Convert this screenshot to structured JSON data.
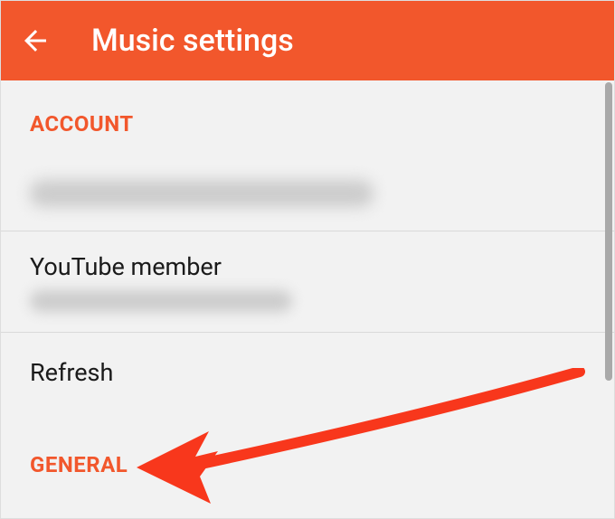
{
  "header": {
    "title": "Music settings",
    "back_icon": "arrow-back"
  },
  "sections": {
    "account": {
      "header": "ACCOUNT",
      "items": {
        "email": {
          "value_redacted": true
        },
        "youtube_member": {
          "title": "YouTube member",
          "subtitle_redacted": true
        },
        "refresh": {
          "title": "Refresh"
        }
      }
    },
    "general": {
      "header": "GENERAL"
    }
  },
  "colors": {
    "accent": "#f2572c",
    "arrow": "#f8371c"
  }
}
